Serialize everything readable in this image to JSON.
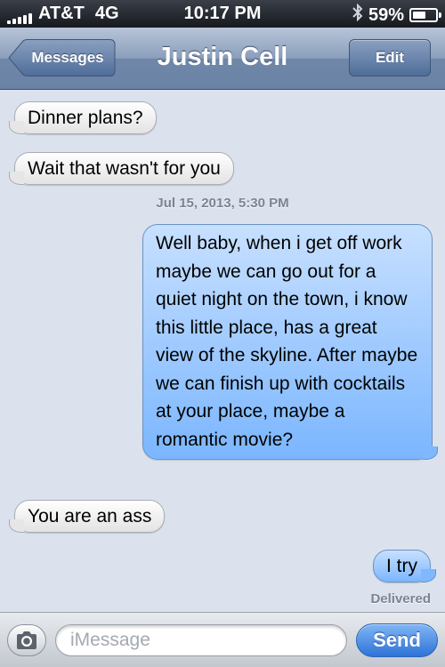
{
  "status_bar": {
    "carrier": "AT&T",
    "network": "4G",
    "time": "10:17 PM",
    "battery_percent_label": "59%",
    "battery_level": 0.59,
    "signal_bars": 5,
    "icons": [
      "signal-bars-icon",
      "bluetooth-icon",
      "battery-icon"
    ]
  },
  "nav": {
    "back_label": "Messages",
    "title": "Justin Cell",
    "edit_label": "Edit"
  },
  "thread": {
    "messages": [
      {
        "direction": "incoming",
        "text": "Dinner plans?"
      },
      {
        "direction": "incoming",
        "text": "Wait that wasn't for you"
      },
      {
        "direction": "outgoing",
        "text": "Well baby, when i get off work maybe we can go out for a quiet night on the town, i know this little place, has a great view of the skyline. After maybe we can finish up with cocktails at your place, maybe a romantic movie?"
      },
      {
        "direction": "incoming",
        "text": "You are an ass"
      },
      {
        "direction": "outgoing",
        "text": "I try"
      }
    ],
    "timestamp": "Jul 15, 2013, 5:30 PM",
    "delivered_label": "Delivered"
  },
  "input_bar": {
    "placeholder": "iMessage",
    "send_label": "Send",
    "camera_icon": "camera-icon"
  },
  "colors": {
    "background": "#dbe2ed",
    "incoming_bubble": "#ececec",
    "outgoing_bubble": "#7bb6ff",
    "send_button": "#2f73d8",
    "nav_bar": "#6f87a8"
  }
}
